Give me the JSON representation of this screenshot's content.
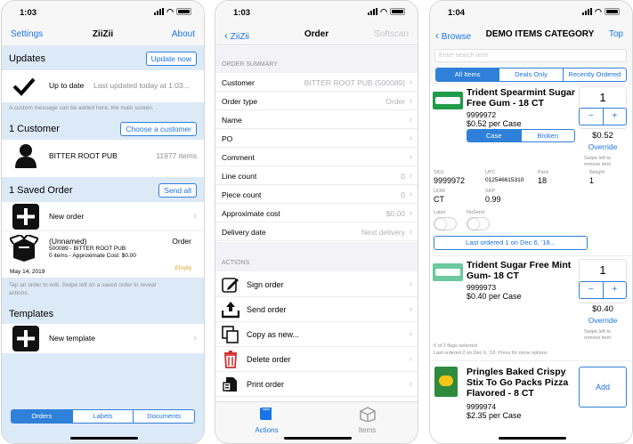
{
  "screen1": {
    "time": "1:03",
    "nav": {
      "left": "Settings",
      "title": "ZiiZii",
      "right": "About"
    },
    "updates": {
      "header": "Updates",
      "button": "Update now",
      "status": "Up to date",
      "last_updated": "Last updated today at 1:03...",
      "note": "A custom message can be added here, the main screen."
    },
    "customer": {
      "header": "1 Customer",
      "button": "Choose a customer",
      "name": "BITTER ROOT PUB",
      "items": "11977 items"
    },
    "saved": {
      "header": "1 Saved Order",
      "button": "Send all",
      "new_order": "New order",
      "order_title": "(Unnamed)",
      "order_type": "Order",
      "order_line1": "500089 - BITTER ROOT PUB",
      "order_line2": "0 items - Approximate Cost: $0.00",
      "order_date": "May 14, 2019",
      "order_status": "Empty",
      "hint": "Tap an order to edit. Swipe left on a saved order to reveal actions."
    },
    "templates": {
      "header": "Templates",
      "new_template": "New template"
    },
    "tabs": [
      "Orders",
      "Labels",
      "Documents"
    ]
  },
  "screen2": {
    "time": "1:03",
    "nav": {
      "left": "ZiiZii",
      "title": "Order",
      "right": "Softscan"
    },
    "summary_header": "ORDER SUMMARY",
    "rows": [
      {
        "label": "Customer",
        "value": "BITTER ROOT PUB (500089)"
      },
      {
        "label": "Order type",
        "value": "Order"
      },
      {
        "label": "Name",
        "value": ""
      },
      {
        "label": "PO",
        "value": ""
      },
      {
        "label": "Comment",
        "value": ""
      },
      {
        "label": "Line count",
        "value": "0"
      },
      {
        "label": "Piece count",
        "value": "0"
      },
      {
        "label": "Approximate cost",
        "value": "$0.00"
      },
      {
        "label": "Delivery date",
        "value": "Next delivery"
      }
    ],
    "actions_header": "ACTIONS",
    "actions": [
      "Sign order",
      "Send order",
      "Copy as new...",
      "Delete order",
      "Print order"
    ],
    "tabs": [
      "Actions",
      "Items"
    ]
  },
  "screen3": {
    "time": "1:04",
    "nav": {
      "left": "Browse",
      "title": "DEMO ITEMS CATEGORY",
      "right": "Top"
    },
    "search_placeholder": "Enter search term",
    "filters": [
      "All Items",
      "Deals Only",
      "Recently Ordered"
    ],
    "items": [
      {
        "name": "Trident Spearmint Sugar Free Gum - 18 CT",
        "code": "9999972",
        "price": "$0.52 per Case",
        "qty": "1",
        "subtotal": "$0.52",
        "override": "Override",
        "swipe": "Swipe left to remove item"
      },
      {
        "name": "Trident Sugar Free Mint Gum- 18 CT",
        "code": "9999973",
        "price": "$0.40 per Case",
        "qty": "1",
        "subtotal": "$0.40",
        "override": "Override",
        "swipe": "Swipe left to remove item"
      },
      {
        "name": "Pringles Baked Crispy Stix To Go Packs Pizza Flavored - 8 CT",
        "code": "9999974",
        "price": "$2.35 per Case",
        "add": "Add"
      }
    ],
    "units": [
      "Case",
      "Broken"
    ],
    "details": {
      "sku_l": "SKU",
      "sku": "9999972",
      "upc_l": "UPC",
      "upc": "012546615310",
      "pack_l": "Pack",
      "pack": "18",
      "uom_l": "UOM",
      "uom": "CT",
      "srp_l": "SRP",
      "srp": "0.99",
      "weight_l": "Weight",
      "weight": "1"
    },
    "label_l": "Label",
    "nosend_l": "NoSend",
    "last_ordered_btn": "Last ordered 1 on Dec 6, '18...",
    "flags": "0 of 2 flags selected",
    "last_ordered_note": "Last ordered 2 on Dec 6, '18. Press for more options"
  }
}
